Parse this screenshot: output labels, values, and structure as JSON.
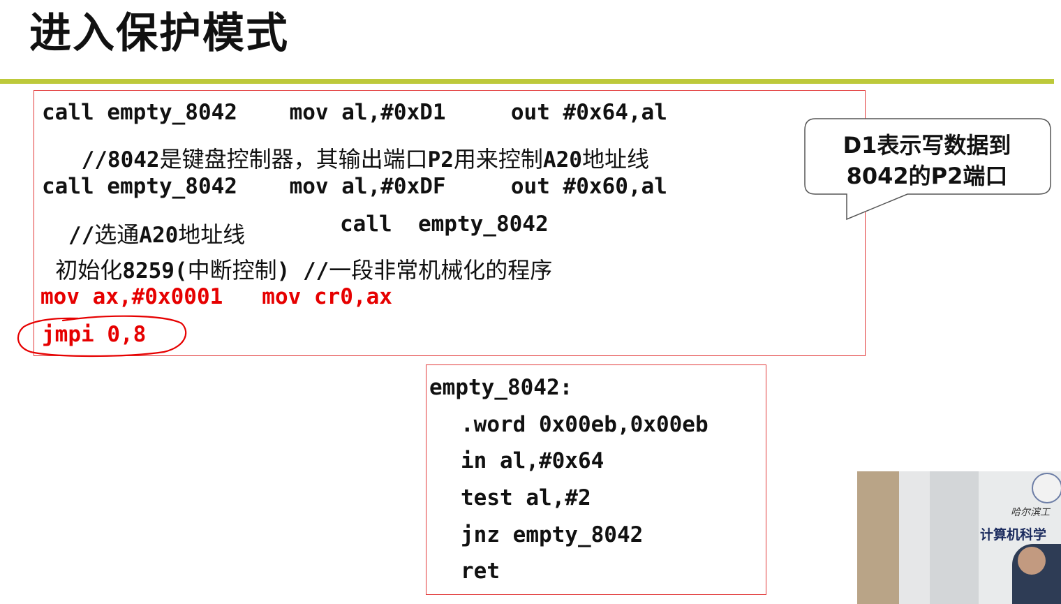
{
  "slide": {
    "title": "进入保护模式"
  },
  "main_code": {
    "line1": "call empty_8042    mov al,#0xD1     out #0x64,al",
    "line2_prefix": "  //8042",
    "line2_text": "是键盘控制器，其输出端口",
    "line2_p2": "P2",
    "line2_text2": "用来控制",
    "line2_a20": "A20",
    "line2_text3": "地址线",
    "line3": "call empty_8042    mov al,#0xDF     out #0x60,al",
    "line4_prefix": " //",
    "line4_text": "选通",
    "line4_a20": "A20",
    "line4_text2": "地址线",
    "line4_call": "call  empty_8042",
    "line5_text": "初始化",
    "line5_num": "8259(",
    "line5_text2": "中断控制",
    "line5_close": ") //",
    "line5_text3": "一段非常机械化的程序",
    "line6": "mov ax,#0x0001   mov cr0,ax",
    "line7": "jmpi 0,8"
  },
  "callout": {
    "line1_bold": "D1",
    "line1_text": "表示写数据到",
    "line2_bold": "8042",
    "line2_text": "的",
    "line2_bold2": "P2",
    "line2_text2": "端口"
  },
  "subroutine": {
    "label": "empty_8042:",
    "lines": [
      ".word 0x00eb,0x00eb",
      "in al,#0x64",
      "test al,#2",
      "jnz empty_8042",
      "ret"
    ]
  },
  "video": {
    "sign_line1": "哈尔滨工",
    "sign_line2": "计算机科学"
  },
  "colors": {
    "accent_rule": "#bdc93a",
    "box_border": "#e23a3a",
    "highlight_text": "#e60000"
  }
}
